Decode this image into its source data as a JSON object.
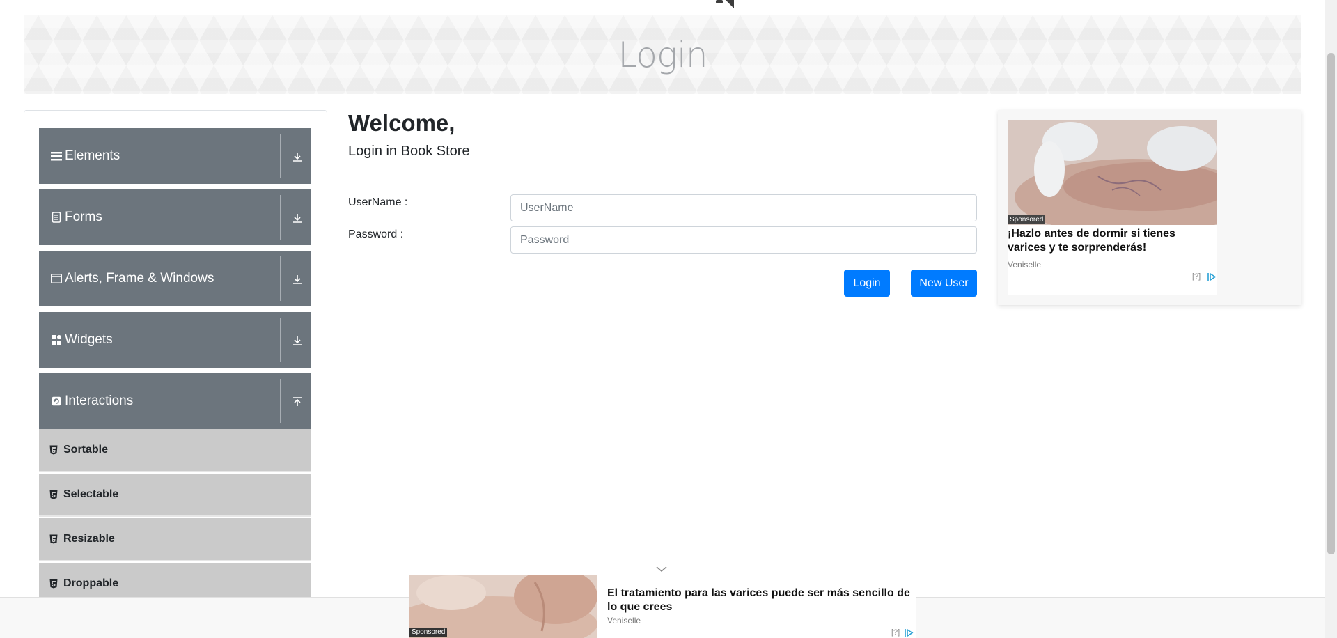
{
  "header": {
    "title": "Login"
  },
  "sidebar": {
    "groups": [
      {
        "label": "Elements",
        "icon": "hamburger-icon",
        "state": "collapsed"
      },
      {
        "label": "Forms",
        "icon": "document-icon",
        "state": "collapsed"
      },
      {
        "label": "Alerts, Frame & Windows",
        "icon": "window-icon",
        "state": "collapsed"
      },
      {
        "label": "Widgets",
        "icon": "widgets-icon",
        "state": "collapsed"
      },
      {
        "label": "Interactions",
        "icon": "refresh-icon",
        "state": "expanded"
      }
    ],
    "items": [
      {
        "label": "Sortable",
        "icon": "html5-icon"
      },
      {
        "label": "Selectable",
        "icon": "html5-icon"
      },
      {
        "label": "Resizable",
        "icon": "html5-icon"
      },
      {
        "label": "Droppable",
        "icon": "html5-icon"
      }
    ]
  },
  "login": {
    "welcome": "Welcome,",
    "subtitle": "Login in Book Store",
    "username_label": "UserName :",
    "username_placeholder": "UserName",
    "username_value": "",
    "password_label": "Password :",
    "password_placeholder": "Password",
    "password_value": "",
    "login_button": "Login",
    "new_user_button": "New User"
  },
  "side_ad": {
    "sponsored": "Sponsored",
    "headline": "¡Hazlo antes de dormir si tienes varices y te sorprenderás!",
    "source": "Veniselle",
    "choices": "[?]"
  },
  "bottom_ad": {
    "sponsored": "Sponsored",
    "headline": "El tratamiento para las varices puede ser más sencillo de lo que crees",
    "source": "Veniselle",
    "choices": "[?]"
  },
  "colors": {
    "menu_header": "#6c757d",
    "menu_item": "#cacaca",
    "primary_button": "#007bff",
    "banner_title": "#a4a7ab"
  }
}
